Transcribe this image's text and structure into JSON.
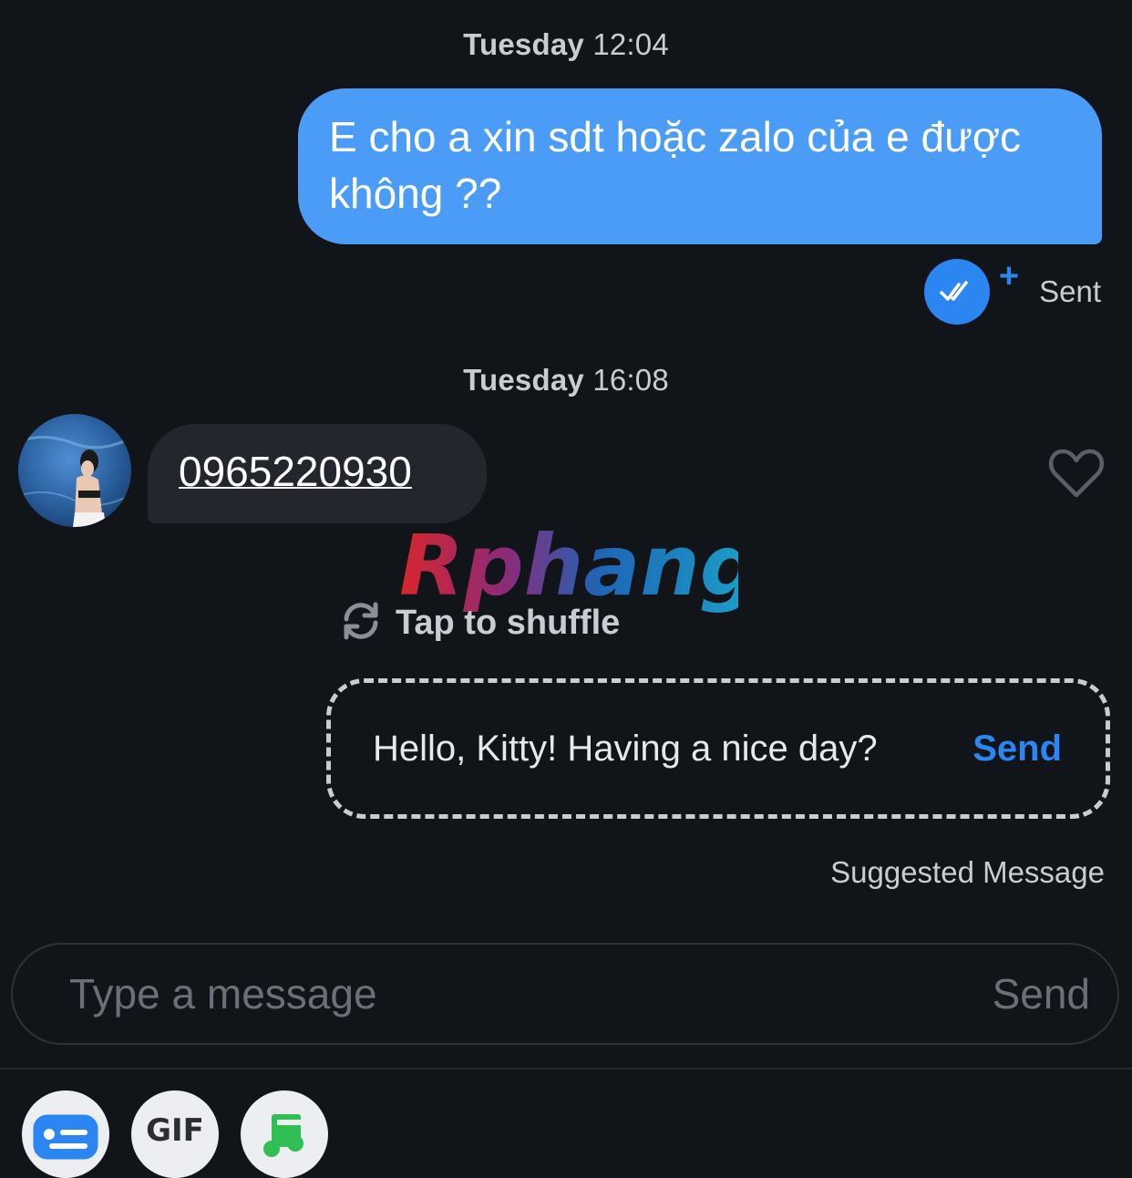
{
  "conversation": {
    "timestamp_1": {
      "day": "Tuesday",
      "time": "12:04"
    },
    "outgoing_message": "E cho a xin sdt hoặc zalo của e được không ??",
    "outgoing_status": "Sent",
    "timestamp_2": {
      "day": "Tuesday",
      "time": "16:08"
    },
    "incoming_message": "0965220930"
  },
  "watermark": {
    "text": "Rphang"
  },
  "suggestion": {
    "shuffle_label": "Tap to shuffle",
    "message": "Hello, Kitty! Having a nice day?",
    "send_label": "Send",
    "caption": "Suggested Message"
  },
  "composer": {
    "placeholder": "Type a message",
    "send_label": "Send"
  },
  "toolbar": {
    "gif_label": "GIF"
  },
  "icons": {
    "read_receipt": "double-check-icon",
    "boost": "plus-icon",
    "like": "heart-icon",
    "shuffle": "refresh-icon",
    "quick_reply": "chat-lines-icon",
    "gif": "gif-icon",
    "music": "music-note-icon"
  },
  "colors": {
    "background": "#111419",
    "outgoing_bubble": "#4a9cf7",
    "incoming_bubble": "#23262d",
    "accent": "#2b86f2",
    "music_green": "#2fbf55"
  }
}
